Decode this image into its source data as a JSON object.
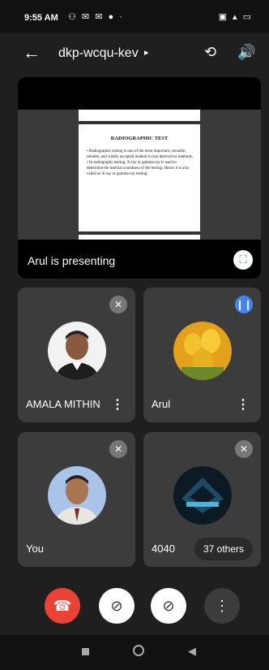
{
  "status_bar": {
    "time": "9:55 AM",
    "left_icons": "⚇ ✉ ✉ ● ·",
    "right_icons": "▣ ▴ ▭"
  },
  "header": {
    "meeting_id": "dkp-wcqu-kev",
    "back_icon": "arrow-back-icon",
    "dropdown": "▸",
    "switch_camera": "⟲",
    "speaker": "🔊"
  },
  "presentation": {
    "label": "Arul is presenting",
    "slide_title": "RADIOGRAPHIC TEST",
    "slide_bullet_1": "• Radiographic testing is one of the most important, versatile, reliable, and widely accepted method in non destructive methods.",
    "slide_bullet_2": "• In radiography testing, X-ray or gamma-ray is used to determine the internal soundness of the testing. Hence it is also called as X-ray or gamma-ray testing.",
    "fullscreen_icon": "⛶"
  },
  "participants": [
    {
      "name": "AMALA MITHIN",
      "muted": true
    },
    {
      "name": "Arul",
      "speaking": true
    },
    {
      "name": "You",
      "muted": true
    },
    {
      "name": "4040",
      "muted": true,
      "others_label": "37 others"
    }
  ],
  "controls": {
    "end_call": "☎",
    "camera": "⊘",
    "mic": "⊘",
    "more": "⋮"
  },
  "colors": {
    "end_call": "#ea4335",
    "accent": "#4285f4",
    "tile_bg": "#3c3c3c"
  }
}
